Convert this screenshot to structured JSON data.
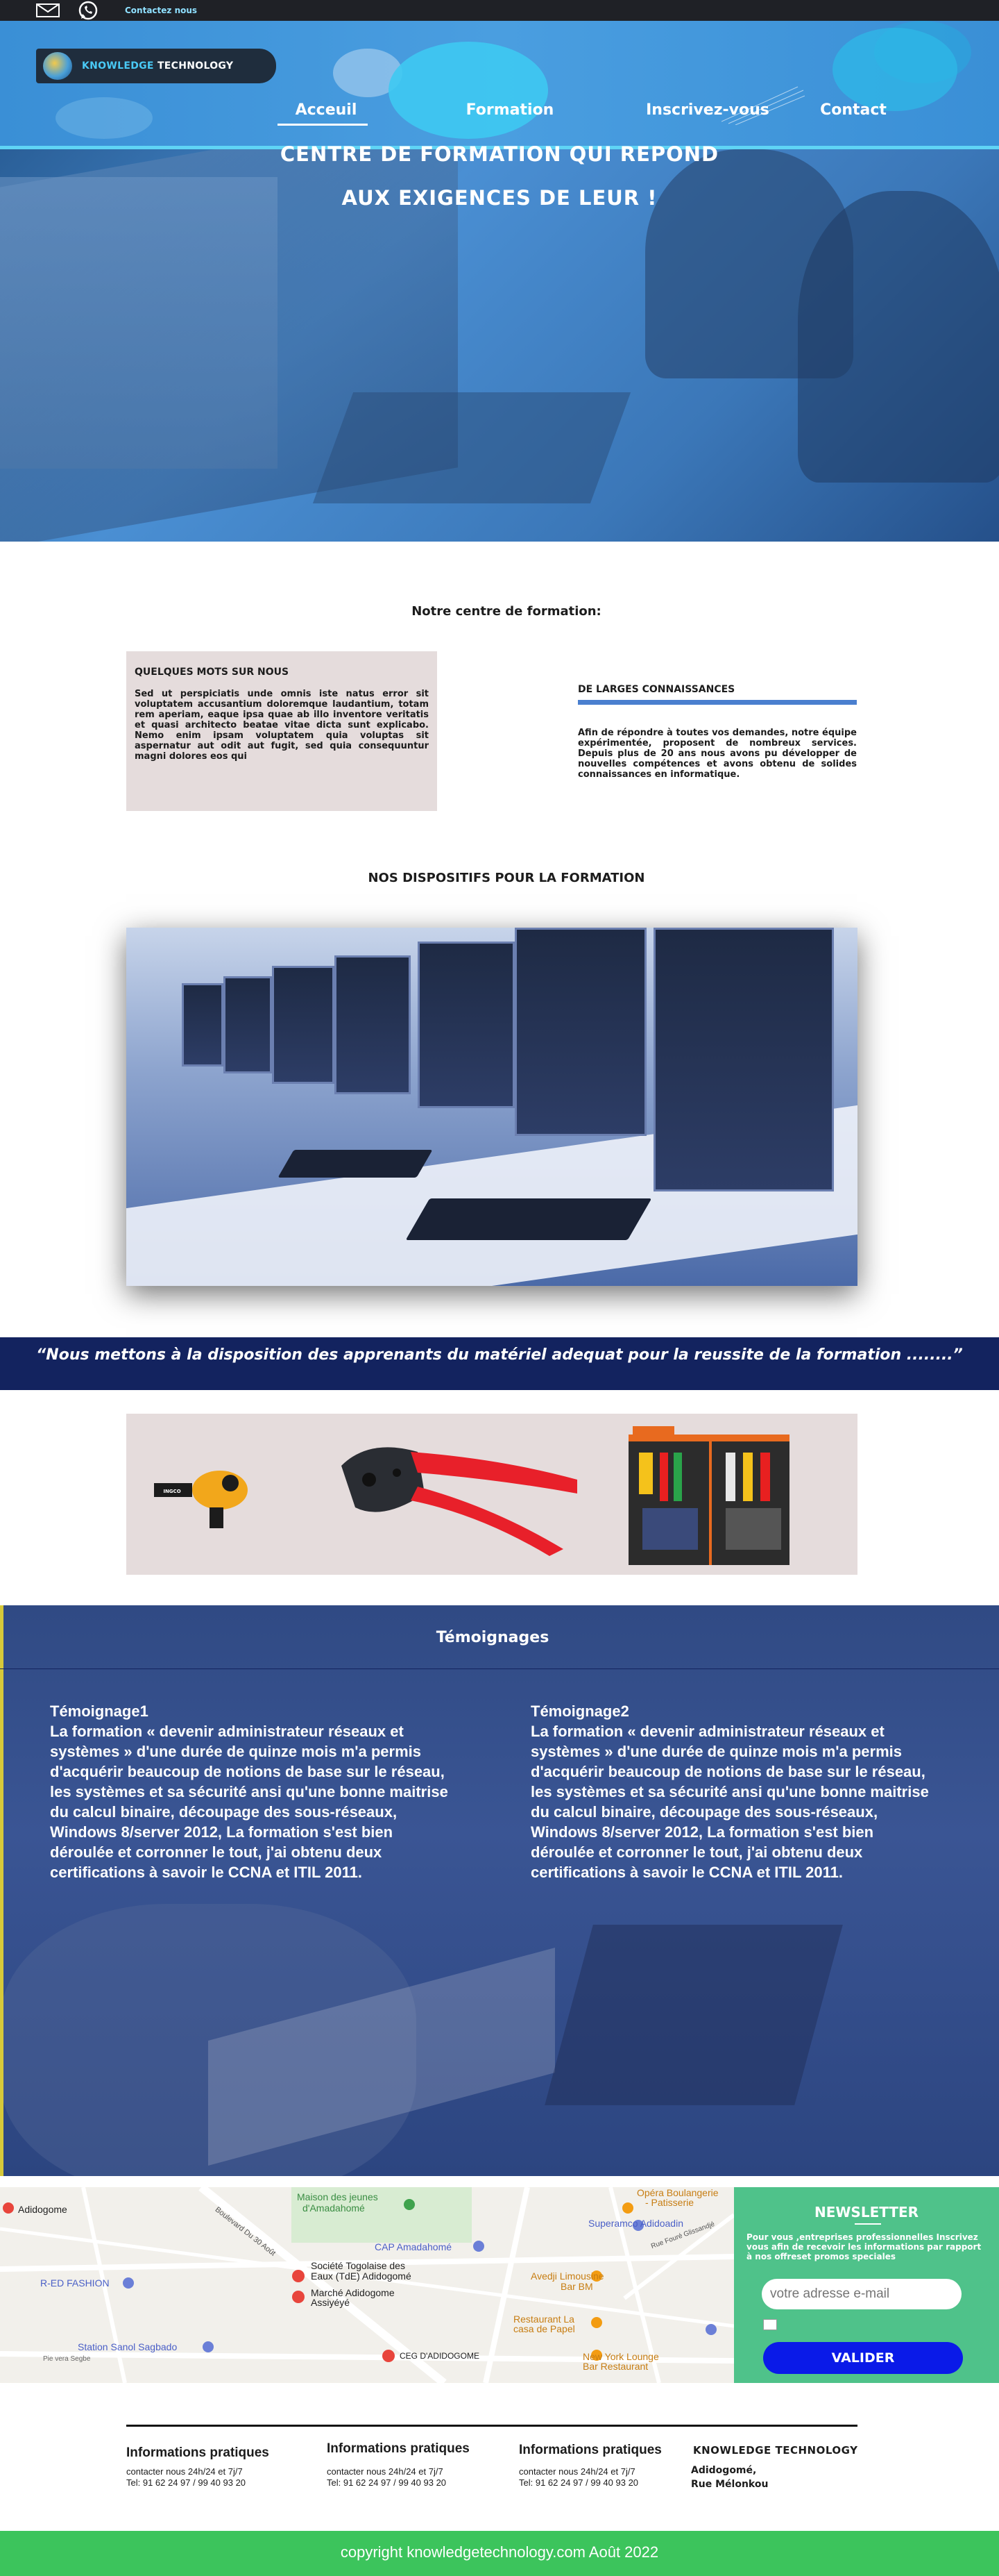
{
  "topbar": {
    "contact_label": "Contactez nous",
    "icons": [
      "mail-icon",
      "whatsapp-icon"
    ]
  },
  "header": {
    "logo_part1": "KNOWLEDGE",
    "logo_part2": " TECHNOLOGY",
    "nav": {
      "home": "Acceuil",
      "formation": "Formation",
      "signup": "Inscrivez-vous",
      "contact": "Contact"
    }
  },
  "hero": {
    "title_line1": "CENTRE DE FORMATION QUI REPOND",
    "title_line2": "AUX  EXIGENCES DE LEUR !"
  },
  "centre": {
    "heading": "Notre centre de formation:",
    "about_title": "QUELQUES MOTS  SUR NOUS",
    "about_text": "Sed ut perspiciatis unde omnis iste natus error sit voluptatem accusantium doloremque laudantium, totam rem aperiam, eaque ipsa quae ab illo inventore veritatis et quasi architecto beatae vitae dicta sunt explicabo. Nemo enim ipsam voluptatem quia voluptas sit aspernatur aut odit aut fugit, sed quia consequuntur magni dolores eos qui",
    "knowledge_title": "DE LARGES CONNAISSANCES",
    "knowledge_text": "Afin de répondre à toutes vos demandes, notre équipe expérimentée, proposent de nombreux services. Depuis plus de 20 ans nous avons pu développer de nouvelles compétences et avons obtenu de solides connaissances en informatique."
  },
  "devices": {
    "heading": "NOS DISPOSITIFS POUR LA FORMATION",
    "quote": "“Nous mettons à la disposition des apprenants du matériel adequat pour la reussite de la formation ........”",
    "tool_label": "INGCO"
  },
  "testimonials": {
    "heading": "Témoignages",
    "items": [
      {
        "title": "Témoignage1",
        "text": "La formation « devenir administrateur réseaux et systèmes » d'une durée de quinze mois m'a permis d'acquérir beaucoup de notions de base sur le réseau, les systèmes et sa sécurité ansi qu'une bonne maitrise du calcul binaire, découpage des sous-réseaux, Windows 8/server 2012, La formation s'est bien déroulée et corronner le tout, j'ai obtenu deux certifications à savoir le CCNA et ITIL 2011."
      },
      {
        "title": "Témoignage2",
        "text": "La formation « devenir administrateur réseaux et systèmes » d'une durée de quinze mois m'a permis d'acquérir beaucoup de notions de base sur le réseau, les systèmes et sa sécurité ansi qu'une bonne maitrise du calcul binaire, découpage des sous-réseaux, Windows 8/server 2012, La formation s'est bien déroulée et corronner le tout, j'ai obtenu deux certifications à savoir le CCNA et ITIL 2011."
      }
    ]
  },
  "map": {
    "labels": {
      "adidogome": "Adidogome",
      "maison_jeunes_1": "Maison des jeunes",
      "maison_jeunes_2": "d'Amadahomé",
      "boulevard": "Boulevard Du 30 Août",
      "opera_1": "Opéra Boulangerie",
      "opera_2": "- Patisserie",
      "superamco": "Superamco Adidoadin",
      "cap": "CAP Amadahomé",
      "togolaise_1": "Société Togolaise des",
      "togolaise_2": "Eaux (TdE) Adidogomé",
      "marche_1": "Marché Adidogome",
      "marche_2": "Assiyéyé",
      "red_fashion": "R-ED FASHION",
      "avedji_1": "Avedji Limousine",
      "avedji_2": "Bar BM",
      "restaurant_1": "Restaurant La",
      "restaurant_2": "casa de Papel",
      "station": "Station Sanol Sagbado",
      "pie_vera": "Pie vera Segbe",
      "ceg": "CEG D'ADIDOGOME",
      "newyork_1": "New York Lounge",
      "newyork_2": "Bar Restaurant",
      "rue": "Rue Fouré Glissandjé"
    }
  },
  "newsletter": {
    "title": "NEWSLETTER",
    "text": "Pour vous ,entreprises professionnelles Inscrivez vous  afin de recevoir les informations par rapport à nos offreset promos speciales",
    "input_placeholder": "votre adresse e-mail",
    "button": "VALIDER"
  },
  "footer": {
    "info_blocks": [
      {
        "title": "Informations pratiques",
        "line1": "contacter nous 24h/24 et 7j/7",
        "line2": "Tel: 91 62 24 97 / 99 40 93 20"
      },
      {
        "title": "Informations pratiques",
        "line1": "contacter nous 24h/24 et 7j/7",
        "line2": "Tel: 91 62 24 97 / 99 40 93 20"
      },
      {
        "title": "Informations pratiques",
        "line1": "contacter nous 24h/24 et 7j/7",
        "line2": "Tel: 91 62 24 97 / 99 40 93 20"
      }
    ],
    "company": "KNOWLEDGE TECHNOLOGY",
    "address_line1": "Adidogomé,",
    "address_line2": "Rue Mélonkou",
    "copyright": "copyright knowledgetechnology.com Août 2022"
  },
  "colors": {
    "header_blue": "#4a9ee0",
    "accent_cyan": "#5fd4f5",
    "navy": "#13235f",
    "newsletter_green": "#4fc28a",
    "copyright_green": "#3cc45c",
    "button_blue": "#0a1ae8"
  }
}
